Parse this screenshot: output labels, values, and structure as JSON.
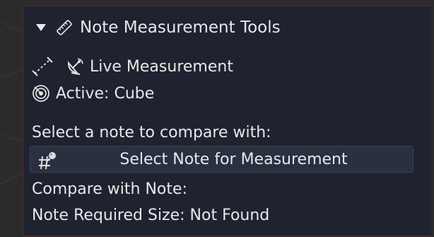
{
  "panel": {
    "title": "Note Measurement Tools",
    "live_measurement_label": "Live Measurement",
    "active_label": "Active: Cube",
    "select_prompt": "Select a note to compare with:",
    "select_button_label": "Select Note for Measurement",
    "compare_label": "Compare with Note:",
    "required_size_label": "Note Required Size: Not Found"
  },
  "icons": {
    "header_toggle": "triangle-down-icon",
    "header": "ruler-icon",
    "live_measure_tool": "measure-line-icon",
    "live_measure": "satellite-dish-icon",
    "active": "target-icon",
    "select_button": "pin-picker-icon"
  },
  "colors": {
    "panel_bg": "#1f2330",
    "panel_border": "#5a2a2a",
    "button_bg": "#2a3040",
    "text": "#e8e8e8"
  }
}
